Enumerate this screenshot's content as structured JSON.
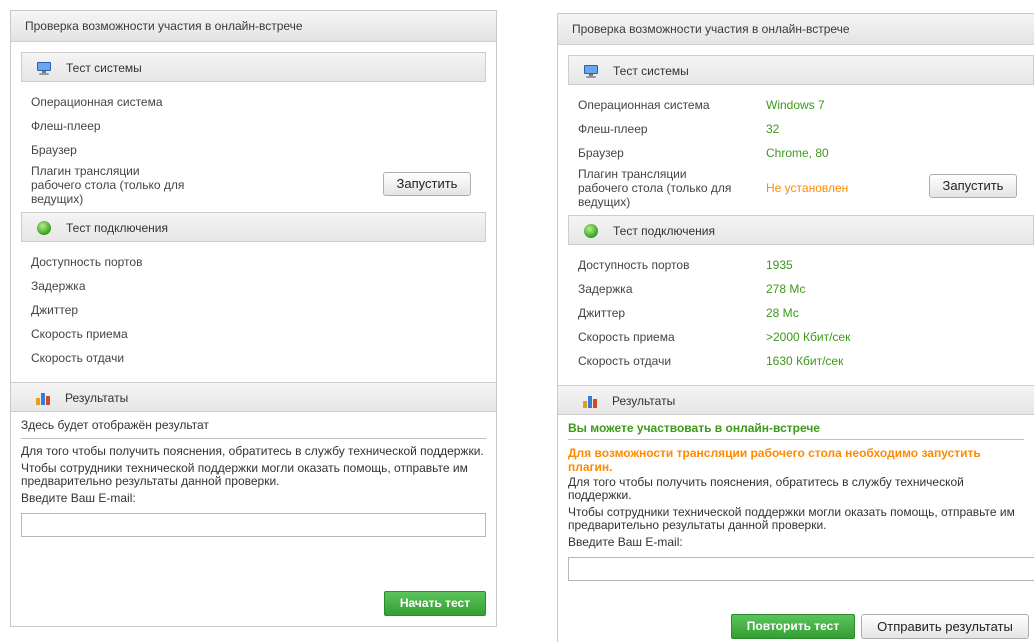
{
  "panel_title": "Проверка возможности участия в онлайн-встрече",
  "system_test": {
    "title": "Тест системы",
    "rows": [
      {
        "label": "Операционная система",
        "value": "Windows 7"
      },
      {
        "label": "Флеш-плеер",
        "value": "32"
      },
      {
        "label": "Браузер",
        "value": "Chrome, 80"
      },
      {
        "label": "Плагин трансляции рабочего стола (только для ведущих)",
        "value": "Не установлен"
      }
    ],
    "launch_button": "Запустить"
  },
  "connection_test": {
    "title": "Тест подключения",
    "rows": [
      {
        "label": "Доступность портов",
        "value": "1935"
      },
      {
        "label": "Задержка",
        "value": "278 Мс"
      },
      {
        "label": "Джиттер",
        "value": "28 Мс"
      },
      {
        "label": "Скорость приема",
        "value": ">2000  Кбит/сек"
      },
      {
        "label": "Скорость отдачи",
        "value": "1630  Кбит/сек"
      }
    ]
  },
  "results": {
    "title": "Результаты",
    "placeholder": "Здесь будет отображён результат",
    "success": "Вы можете участвовать в онлайн-встрече",
    "warning": "Для возможности трансляции рабочего стола необходимо запустить плагин.",
    "support_text": "Для того чтобы получить пояснения, обратитесь в службу технической поддержки.",
    "send_text": "Чтобы сотрудники технической поддержки могли оказать помощь, отправьте им предварительно результаты данной проверки.",
    "email_label": "Введите Ваш E-mail:",
    "email_value": ""
  },
  "buttons": {
    "start_test": "Начать тест",
    "repeat_test": "Повторить тест",
    "send_results": "Отправить результаты"
  },
  "colors": {
    "ok": "#3b9a18",
    "warning": "#ff8a00",
    "button_green": "#33a033"
  },
  "icons": {
    "system": "monitor-icon",
    "connection": "green-globe-icon",
    "results": "bar-chart-icon"
  }
}
